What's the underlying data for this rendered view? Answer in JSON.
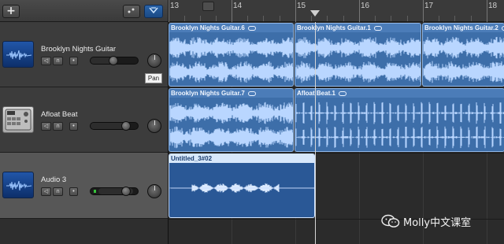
{
  "header": {
    "add_label": "+",
    "smart_controls_icon": "smart-controls-icon",
    "filter_icon": "filter-icon"
  },
  "ruler": {
    "bars": [
      "13",
      "14",
      "15",
      "16",
      "17",
      "18"
    ]
  },
  "tracks": [
    {
      "name": "Brooklyn Nights Guitar",
      "icon": "waveform-icon",
      "color": "#2156a8"
    },
    {
      "name": "Afloat Beat",
      "icon": "drum-machine-icon",
      "color": "#c9c9c9"
    },
    {
      "name": "Audio 3",
      "icon": "waveform-icon",
      "color": "#2156a8"
    }
  ],
  "tooltip": {
    "pan": "Pan"
  },
  "regions": {
    "r1": "Brooklyn Nights Guitar.6",
    "r2": "Brooklyn Nights Guitar.1",
    "r3": "Brooklyn Nights Guitar.2",
    "r4": "Brooklyn Nights Guitar.7",
    "r5": "Afloat Beat.1",
    "r6": "Untitled_3#02"
  },
  "watermark": {
    "text": "Molly中文课室"
  },
  "colors": {
    "region": "#3d6ea9",
    "region_selected": "#2a5896",
    "accent": "#2a63a8"
  }
}
